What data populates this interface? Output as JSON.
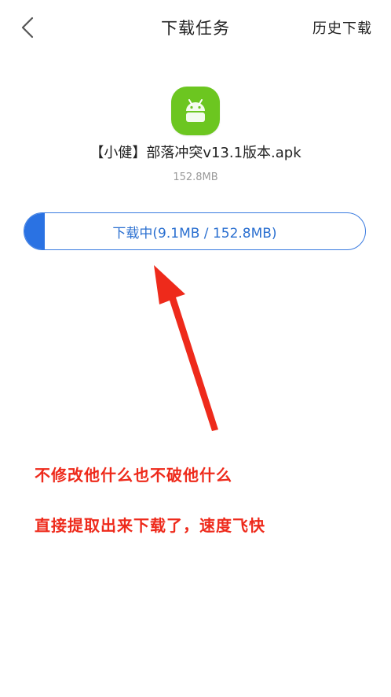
{
  "header": {
    "title": "下载任务",
    "history_label": "历史下载"
  },
  "app": {
    "icon": "android-icon",
    "filename": "【小健】部落冲突v13.1版本.apk",
    "size": "152.8MB"
  },
  "download": {
    "label": "下载中(9.1MB / 152.8MB)",
    "downloaded_mb": 9.1,
    "total_mb": 152.8
  },
  "annotation": {
    "line1": "不修改他什么也不破他什么",
    "line2": "直接提取出来下载了，速度飞快",
    "color": "#ee2a1b"
  },
  "colors": {
    "accent": "#2a72e3",
    "icon_bg": "#6cc620"
  }
}
